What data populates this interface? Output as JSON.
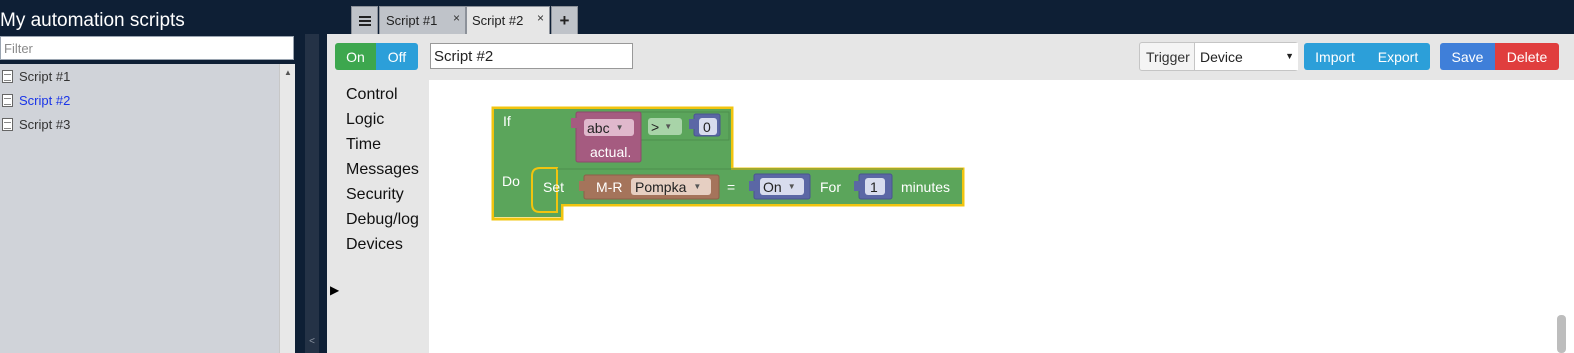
{
  "app": {
    "title": "My automation scripts"
  },
  "filter": {
    "placeholder": "Filter",
    "value": ""
  },
  "scripts": [
    {
      "label": "Script #1"
    },
    {
      "label": "Script #2"
    },
    {
      "label": "Script #3"
    }
  ],
  "tabs": [
    {
      "label": "Script #1",
      "close": "×"
    },
    {
      "label": "Script #2",
      "close": "×"
    }
  ],
  "toolbar": {
    "on_label": "On",
    "off_label": "Off",
    "script_name": "Script #2",
    "trigger_label": "Trigger",
    "trigger_value": "Device",
    "import_label": "Import",
    "export_label": "Export",
    "save_label": "Save",
    "delete_label": "Delete"
  },
  "toolbox": {
    "categories": [
      "Control",
      "Logic",
      "Time",
      "Messages",
      "Security",
      "Debug/log",
      "Devices"
    ]
  },
  "blocks": {
    "if_label": "If",
    "do_label": "Do",
    "var_name": "abc",
    "var_field": "actual.",
    "operator": ">",
    "compare_value": "0",
    "set_label": "Set",
    "device_prefix": "M-R",
    "device_name": "Pompka",
    "equals": "=",
    "state_value": "On",
    "for_label": "For",
    "duration_value": "1",
    "unit_label": "minutes"
  },
  "colors": {
    "background": "#0e1f35",
    "on_green": "#3da74e",
    "accent_blue": "#2c9fd9",
    "save_blue": "#3f7fd9",
    "delete_red": "#e03e3e",
    "block_green": "#5ba55b",
    "block_highlight": "#f1c40f",
    "var_purple": "#a55b80",
    "device_brown": "#a5745b",
    "value_blue": "#5b67a5",
    "active_script": "#1a35e8"
  },
  "icons": {
    "tab_list": "list-icon",
    "add_tab": "plus-icon",
    "script_item": "document-icon",
    "collapse": "chevron-left-icon",
    "expanded_category": "triangle-right-icon"
  }
}
